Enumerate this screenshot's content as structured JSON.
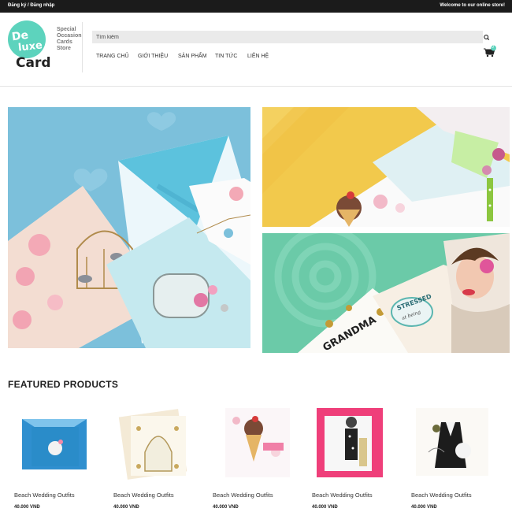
{
  "colors": {
    "topbar": "#1b1b1b",
    "brand": "#5dd3bd",
    "search_bg": "#eaeaea"
  },
  "topbar": {
    "login_label": "Đăng ký / Đăng nhập",
    "welcome": "Welcome to our online store!"
  },
  "logo": {
    "line1": "De",
    "line2": "luxe",
    "line3": "Card",
    "tagline": [
      "Special",
      "Occasion",
      "Cards",
      "Store"
    ]
  },
  "search": {
    "placeholder": "Tìm kiếm",
    "icon": "search-icon"
  },
  "nav": {
    "items": [
      "TRANG CHỦ",
      "GIỚI THIỆU",
      "SẢN PHẨM",
      "TIN TỨC",
      "LIÊN HỆ"
    ]
  },
  "cart": {
    "icon": "cart-icon",
    "count": "0"
  },
  "banners": {
    "b3_card_text": {
      "grandma": "GRANDMA",
      "stressed_top": "STRESSED",
      "stressed_bottom": "at being"
    }
  },
  "featured": {
    "heading": "FEATURED PRODUCTS"
  },
  "products": [
    {
      "name": "Beach Wedding Outfits",
      "price": "40.000 VNĐ"
    },
    {
      "name": "Beach Wedding Outfits",
      "price": "40.000 VNĐ"
    },
    {
      "name": "Beach Wedding Outfits",
      "price": "40.000 VNĐ"
    },
    {
      "name": "Beach Wedding Outfits",
      "price": "40.000 VNĐ"
    },
    {
      "name": "Beach Wedding Outfits",
      "price": "40.000 VNĐ"
    }
  ]
}
